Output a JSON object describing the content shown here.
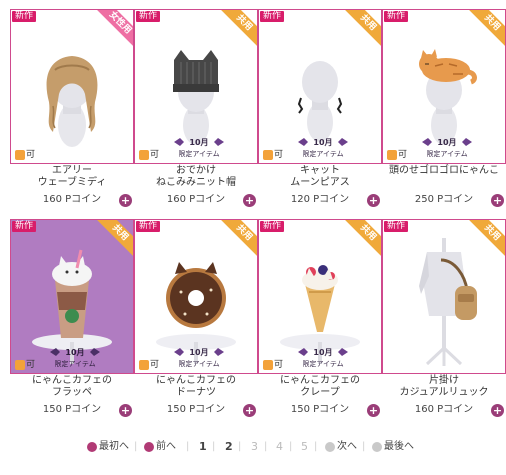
{
  "badge_new": "新作",
  "ok_label": "可",
  "limited_text": "10月 限定アイテム",
  "items": [
    {
      "name1": "エアリー",
      "name2": "ウェーブミディ",
      "price": "160 Pコイン",
      "tag": "女性用",
      "limited": false,
      "type": "hair"
    },
    {
      "name1": "おでかけ",
      "name2": "ねこみみニット帽",
      "price": "160 Pコイン",
      "tag": "共用",
      "limited": true,
      "type": "hat"
    },
    {
      "name1": "キャット",
      "name2": "ムーンピアス",
      "price": "120 Pコイン",
      "tag": "共用",
      "limited": true,
      "type": "earring"
    },
    {
      "name1": "頭のせゴロゴロにゃんこ",
      "name2": "",
      "price": "250 Pコイン",
      "tag": "共用",
      "limited": true,
      "type": "cat"
    },
    {
      "name1": "にゃんこカフェの",
      "name2": "フラッペ",
      "price": "150 Pコイン",
      "tag": "共用",
      "limited": true,
      "type": "frappe"
    },
    {
      "name1": "にゃんこカフェの",
      "name2": "ドーナツ",
      "price": "150 Pコイン",
      "tag": "共用",
      "limited": true,
      "type": "donut"
    },
    {
      "name1": "にゃんこカフェの",
      "name2": "クレープ",
      "price": "150 Pコイン",
      "tag": "共用",
      "limited": true,
      "type": "crepe"
    },
    {
      "name1": "片掛け",
      "name2": "カジュアルリュック",
      "price": "160 Pコイン",
      "tag": "共用",
      "limited": false,
      "type": "bag"
    }
  ],
  "pager": {
    "first": "最初へ",
    "prev": "前へ",
    "pages": [
      "1",
      "2",
      "3",
      "4",
      "5"
    ],
    "current": "2",
    "next": "次へ",
    "last": "最後へ",
    "sep": "|"
  }
}
